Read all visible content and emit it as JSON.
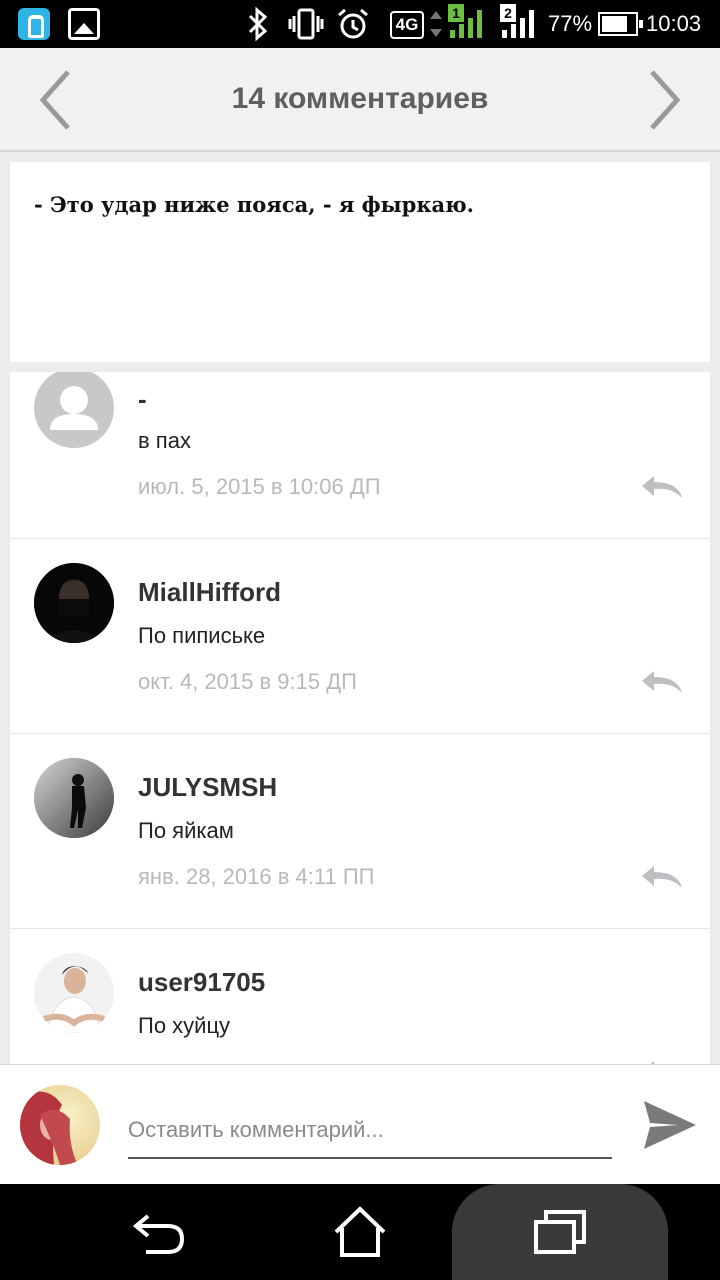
{
  "status_bar": {
    "icons": [
      "fitness-app-icon",
      "gallery-icon",
      "bluetooth-icon",
      "vibrate-icon",
      "alarm-icon",
      "network-4g-icon",
      "signal-sim1-icon",
      "signal-sim2-icon",
      "battery-icon"
    ],
    "network_type": "4G",
    "sim1_label": "1",
    "sim2_label": "2",
    "battery_percent_text": "77%",
    "battery_level": 0.77,
    "time": "10:03"
  },
  "toolbar": {
    "title": "14 комментариев"
  },
  "quote": {
    "text": "- Это удар ниже пояса, - я фыркаю."
  },
  "comments": [
    {
      "username": "-",
      "text": "в пах",
      "date": "июл. 5, 2015 в 10:06 ДП"
    },
    {
      "username": "MiallHifford",
      "text": "По пипиське",
      "date": "окт. 4, 2015 в 9:15 ДП"
    },
    {
      "username": "JULYSMSH",
      "text": "По яйкам",
      "date": "янв. 28, 2016 в 4:11 ПП"
    },
    {
      "username": "user91705",
      "text": "По хуйцу",
      "date": ""
    }
  ],
  "comment_input": {
    "placeholder": "Оставить комментарий..."
  },
  "colors": {
    "accent_fitness": "#2fb4e8",
    "toolbar_bg": "#f1f1f3",
    "date_text": "#b8b8bc",
    "page_bg": "#ececef"
  }
}
